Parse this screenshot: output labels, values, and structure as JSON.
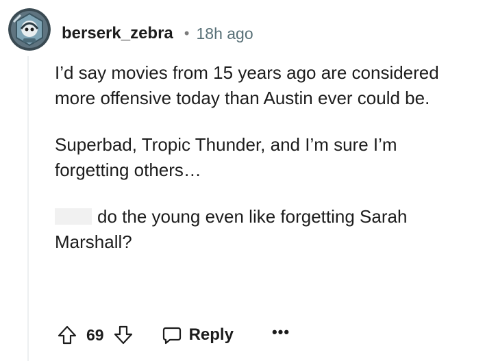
{
  "comment": {
    "author": "berserk_zebra",
    "separator": "•",
    "timestamp": "18h ago",
    "paragraphs": [
      "I’d say movies from 15 years ago are considered more offensive today than Austin ever could be.",
      "Superbad, Tropic Thunder, and I’m sure I’m forgetting others…",
      "do the young even like forgetting Sarah Marshall?"
    ],
    "score": "69",
    "reply_label": "Reply",
    "more_label": "•••",
    "icons": {
      "upvote": "upvote-arrow-icon",
      "downvote": "downvote-arrow-icon",
      "reply": "speech-bubble-icon",
      "more": "ellipsis-icon"
    },
    "colors": {
      "text": "#1c1c1c",
      "meta": "#576f76",
      "thread_line": "#edeff1",
      "redaction": "#f1f1f1"
    }
  }
}
